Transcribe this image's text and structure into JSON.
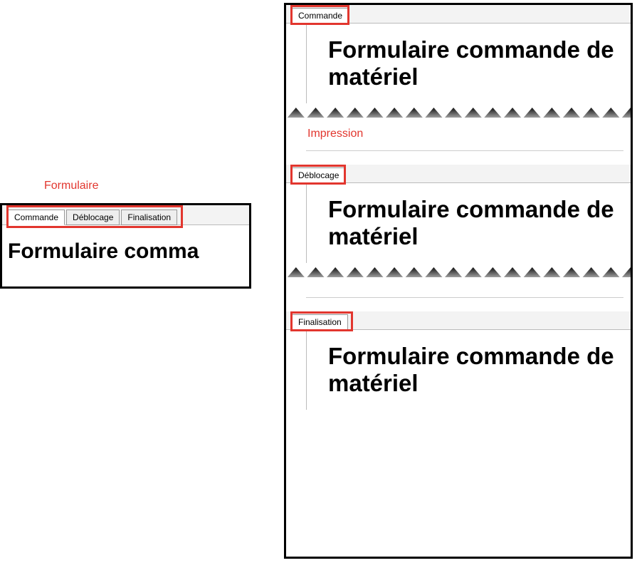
{
  "labels": {
    "formulaire": "Formulaire",
    "impression": "Impression"
  },
  "form": {
    "tabs": {
      "commande": "Commande",
      "deblocage": "Déblocage",
      "finalisation": "Finalisation"
    },
    "title": "Formulaire comma"
  },
  "print": {
    "commande_tab": "Commande",
    "commande_title": "Formulaire commande de matériel",
    "deblocage_tab": "Déblocage",
    "deblocage_title": "Formulaire commande de matériel",
    "finalisation_tab": "Finalisation",
    "finalisation_title": "Formulaire commande de matériel"
  }
}
